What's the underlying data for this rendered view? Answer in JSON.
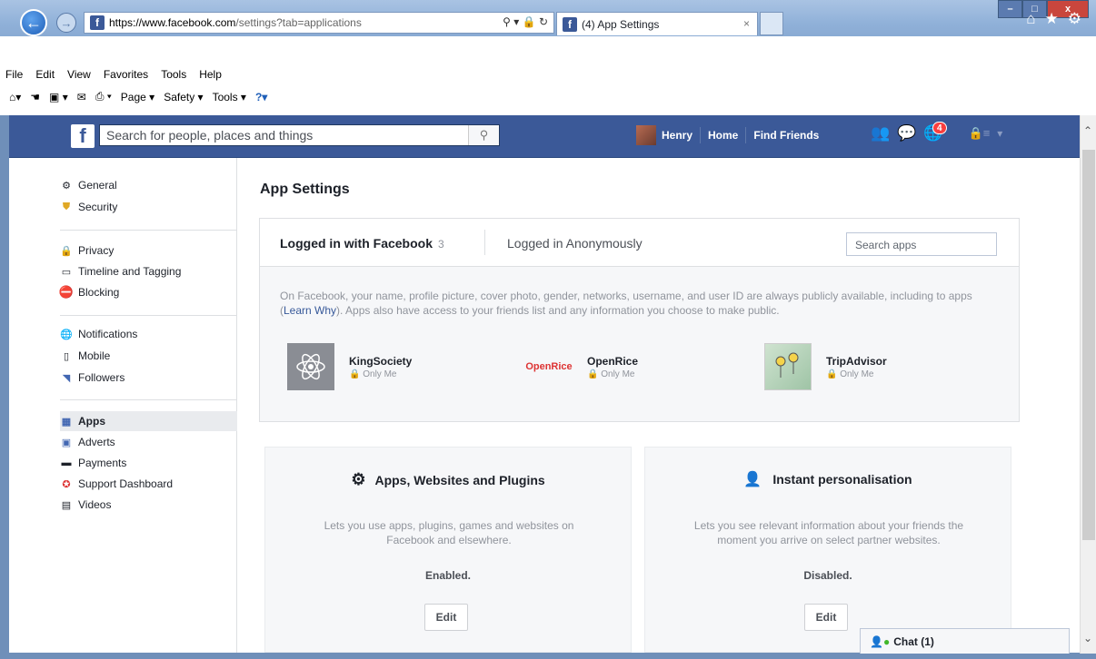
{
  "browser": {
    "url_main": "https://www.facebook.com",
    "url_rest": "/settings?tab=applications",
    "tab_title": "(4) App Settings",
    "tab_close": "×",
    "menus": [
      "File",
      "Edit",
      "View",
      "Favorites",
      "Tools",
      "Help"
    ],
    "commands": [
      "Page ▾",
      "Safety ▾",
      "Tools ▾"
    ],
    "win_min": "–",
    "win_max": "□",
    "win_close": "x"
  },
  "fb": {
    "search_placeholder": "Search for people, places and things",
    "user": "Henry",
    "nav": [
      "Home",
      "Find Friends"
    ],
    "notif_count": "4"
  },
  "sidebar": {
    "groups": [
      [
        {
          "label": "General",
          "icon": "gears-icon"
        },
        {
          "label": "Security",
          "icon": "badge-icon"
        }
      ],
      [
        {
          "label": "Privacy",
          "icon": "lock-icon"
        },
        {
          "label": "Timeline and Tagging",
          "icon": "timeline-icon"
        },
        {
          "label": "Blocking",
          "icon": "block-icon"
        }
      ],
      [
        {
          "label": "Notifications",
          "icon": "globe-icon"
        },
        {
          "label": "Mobile",
          "icon": "phone-icon"
        },
        {
          "label": "Followers",
          "icon": "rss-icon"
        }
      ],
      [
        {
          "label": "Apps",
          "icon": "apps-icon"
        },
        {
          "label": "Adverts",
          "icon": "adverts-icon"
        },
        {
          "label": "Payments",
          "icon": "card-icon"
        },
        {
          "label": "Support Dashboard",
          "icon": "lifebuoy-icon"
        },
        {
          "label": "Videos",
          "icon": "film-icon"
        }
      ]
    ],
    "active": "Apps"
  },
  "main": {
    "title": "App Settings",
    "tab_logged_fb": "Logged in with Facebook",
    "tab_logged_fb_count": "3",
    "tab_anon": "Logged in Anonymously",
    "search_apps": "Search apps",
    "info_pre": "On Facebook, your name, profile picture, cover photo, gender, networks, username, and user ID are always publicly available, including to apps (",
    "info_link": "Learn Why",
    "info_post": "). Apps also have access to your friends list and any information you choose to make public.",
    "apps": [
      {
        "name": "KingSociety",
        "visibility": "Only Me"
      },
      {
        "name": "OpenRice",
        "visibility": "Only Me"
      },
      {
        "name": "TripAdvisor",
        "visibility": "Only Me"
      }
    ],
    "cards": [
      {
        "title": "Apps, Websites and Plugins",
        "desc": "Lets you use apps, plugins, games and websites on Facebook and elsewhere.",
        "status": "Enabled.",
        "button": "Edit"
      },
      {
        "title": "Instant personalisation",
        "desc": "Lets you see relevant information about your friends the moment you arrive on select partner websites.",
        "status": "Disabled.",
        "button": "Edit"
      }
    ]
  },
  "chat": {
    "label": "Chat (1)"
  },
  "colors": {
    "fb_blue": "#3b5998",
    "link": "#365899",
    "badge": "#fa3e3e"
  }
}
